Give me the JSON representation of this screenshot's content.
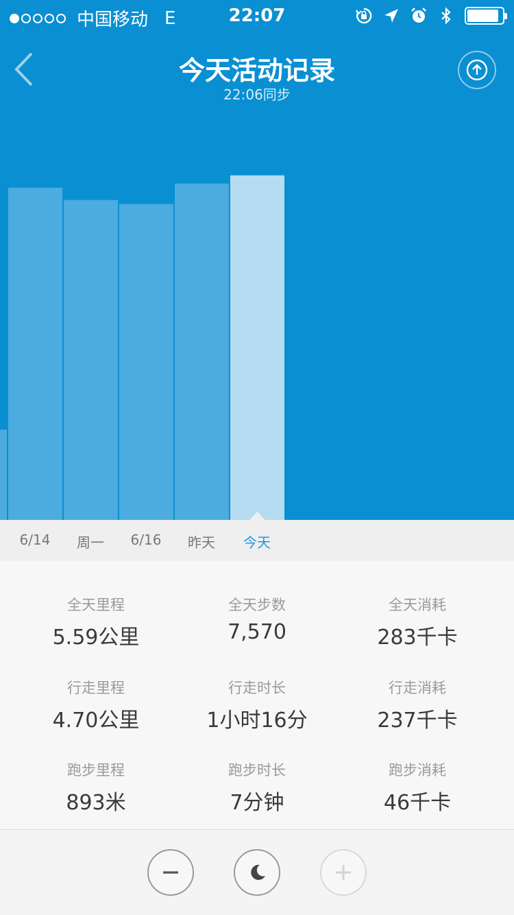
{
  "status_bar": {
    "carrier": "中国移动",
    "network": "E",
    "time": "22:07",
    "signal_dots": [
      true,
      false,
      false,
      false,
      false
    ]
  },
  "nav": {
    "title": "今天活动记录",
    "subtitle": "22:06同步"
  },
  "chart_data": {
    "type": "bar",
    "categories": [
      "6/14",
      "周一",
      "6/16",
      "昨天",
      "今天"
    ],
    "values": [
      0.81,
      0.78,
      0.77,
      0.82,
      0.84
    ],
    "selected_index": 4,
    "partial_bar_left": 0.22,
    "bar_color": "#4cacdf",
    "selected_bar_color": "#b6dcf1"
  },
  "stats": [
    [
      {
        "label": "全天里程",
        "value": "5.59公里"
      },
      {
        "label": "全天步数",
        "value": "7,570"
      },
      {
        "label": "全天消耗",
        "value": "283千卡"
      }
    ],
    [
      {
        "label": "行走里程",
        "value": "4.70公里"
      },
      {
        "label": "行走时长",
        "value": "1小时16分"
      },
      {
        "label": "行走消耗",
        "value": "237千卡"
      }
    ],
    [
      {
        "label": "跑步里程",
        "value": "893米"
      },
      {
        "label": "跑步时长",
        "value": "7分钟"
      },
      {
        "label": "跑步消耗",
        "value": "46千卡"
      }
    ]
  ],
  "controls": {
    "icons": [
      "minus-icon",
      "moon-icon",
      "plus-icon"
    ]
  }
}
